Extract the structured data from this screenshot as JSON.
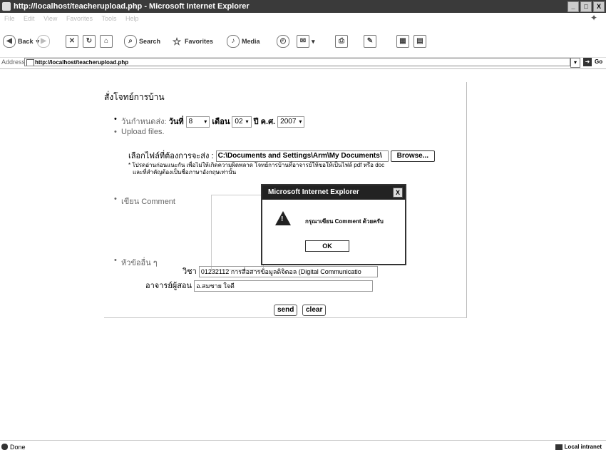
{
  "window": {
    "title": "http://localhost/teacherupload.php - Microsoft Internet Explorer",
    "controls": [
      "_",
      "□",
      "X"
    ]
  },
  "menubar": {
    "items": [
      "File",
      "Edit",
      "View",
      "Favorites",
      "Tools",
      "Help"
    ]
  },
  "toolbar": {
    "back_label": "Back",
    "back_icon": "◀",
    "search_label": "Search",
    "favorites_label": "Favorites",
    "media_label": "Media"
  },
  "address": {
    "label": "Address",
    "url": "http://localhost/teacherupload.php",
    "go_label": "Go"
  },
  "form": {
    "heading": "สั่งโจทย์การบ้าน",
    "deadline_label": "วันกำหนดส่ง:",
    "day_label": "วันที่",
    "day_value": "8",
    "month_label": "เดือน",
    "month_value": "02",
    "year_label": "ปี ค.ศ.",
    "year_value": "2007",
    "upload_label": "Upload files.",
    "choose_file_label": "เลือกไฟล์ที่ต้องการจะส่ง :",
    "file_path": "C:\\Documents and Settings\\Arm\\My Documents\\",
    "browse_label": "Browse...",
    "note_line1": "* โปรดอ่านก่อนแนะกัน เพื่อไม่ให้เกิดความผิดพลาด โจทย์การบ้านที่อาจารย์ให้ขอให้เป็นไฟล์ pdf หรือ doc",
    "note_line2": "และที่สำคัญต้องเป็นชื่อภาษาอังกฤษเท่านั้น",
    "comment_label": "เขียน Comment",
    "other_label": "หัวข้ออื่น ๆ",
    "subject_label": "วิชา",
    "subject_value": "01232112 การสื่อสารข้อมูลดิจิตอล (Digital Communicatio",
    "teacher_label": "อาจารย์ผู้สอน",
    "teacher_value": "อ.สมชาย ใจดี",
    "send_label": "send",
    "clear_label": "clear"
  },
  "dialog": {
    "title": "Microsoft Internet Explorer",
    "close_label": "X",
    "message": "กรุณาเขียน Comment ด้วยครับ",
    "ok_label": "OK"
  },
  "status": {
    "text": "Done",
    "zone": "Local intranet"
  }
}
